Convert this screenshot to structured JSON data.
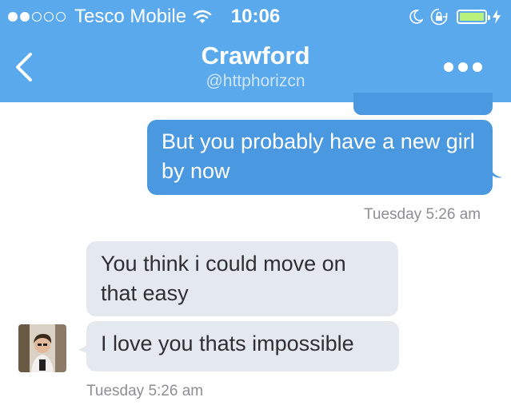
{
  "status_bar": {
    "carrier": "Tesco Mobile",
    "time": "10:06",
    "signal_bars_full": 2,
    "signal_bars_total": 5,
    "icons": [
      "wifi-icon",
      "moon-icon",
      "rotation-lock-icon",
      "battery-icon",
      "charging-bolt-icon"
    ],
    "battery_level": 1.0,
    "battery_color": "#b7f07a"
  },
  "header": {
    "title": "Crawford",
    "handle": "@httphorizcn",
    "back_icon": "chevron-left-icon",
    "more_icon": "more-dots-icon",
    "background": "#5aa9ec"
  },
  "messages": [
    {
      "direction": "outgoing",
      "text": "But you probably have a new girl by now"
    },
    {
      "direction": "incoming",
      "text": "You think i could move on that easy"
    },
    {
      "direction": "incoming",
      "text": "I love you thats impossible"
    }
  ],
  "timestamps": {
    "outgoing": "Tuesday 5:26 am",
    "incoming": "Tuesday 5:26 am"
  },
  "colors": {
    "outgoing_bubble": "#4a98df",
    "incoming_bubble": "#e4e8ef",
    "timestamp": "#8e8e93"
  }
}
